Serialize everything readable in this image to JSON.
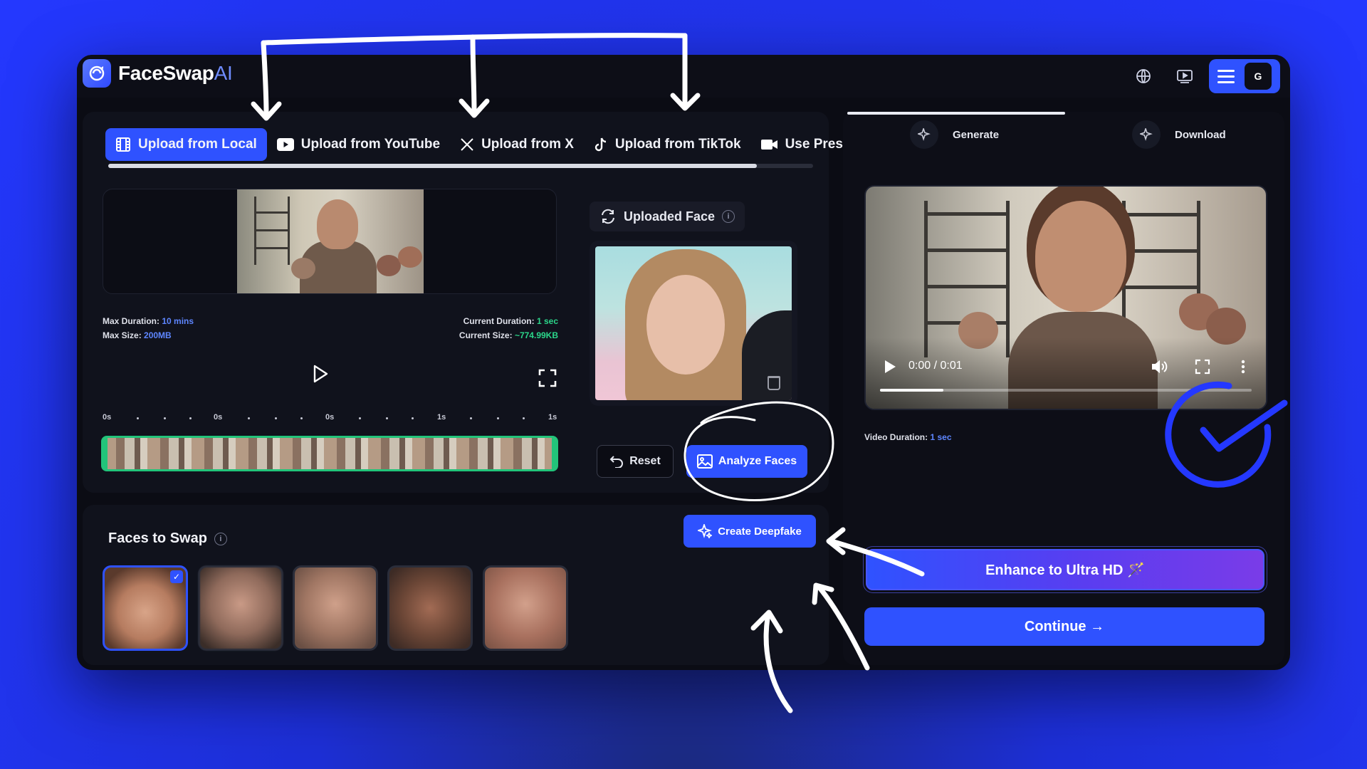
{
  "app": {
    "brand_main": "FaceSwap",
    "brand_accent": "AI",
    "user_initial": "G"
  },
  "upload_tabs": [
    {
      "label": "Upload from Local",
      "icon": "film-icon",
      "active": true
    },
    {
      "label": "Upload from YouTube",
      "icon": "youtube-icon",
      "active": false
    },
    {
      "label": "Upload from X",
      "icon": "x-logo-icon",
      "active": false
    },
    {
      "label": "Upload from TikTok",
      "icon": "tiktok-icon",
      "active": false
    },
    {
      "label": "Use Preset",
      "icon": "video-camera-icon",
      "active": false
    }
  ],
  "source_video": {
    "max_duration_label": "Max Duration:",
    "max_duration_value": "10 mins",
    "max_size_label": "Max Size:",
    "max_size_value": "200MB",
    "current_duration_label": "Current Duration:",
    "current_duration_value": "1 sec",
    "current_size_label": "Current Size:",
    "current_size_value": "~774.99KB",
    "timeline_ticks": [
      "0s",
      "0s",
      "0s",
      "1s",
      "1s"
    ]
  },
  "uploaded_face": {
    "label": "Uploaded Face",
    "info": "i"
  },
  "actions": {
    "reset": "Reset",
    "analyze": "Analyze Faces",
    "create_deepfake": "Create Deepfake"
  },
  "faces_to_swap": {
    "title": "Faces to Swap",
    "info": "i",
    "selected_index": 0,
    "count": 5
  },
  "output": {
    "steps": [
      {
        "label": "Generate",
        "icon": "sparkle-icon"
      },
      {
        "label": "Download",
        "icon": "sparkle-icon"
      }
    ],
    "player_time": "0:00 / 0:01",
    "player_progress": 0.17,
    "video_duration_label": "Video Duration:",
    "video_duration_value": "1 sec",
    "enhance_label": "Enhance to Ultra HD 🪄",
    "continue_label": "Continue →"
  },
  "colors": {
    "accent": "#2f52ff",
    "success": "#22c47a",
    "page_background": "#2438ff"
  }
}
